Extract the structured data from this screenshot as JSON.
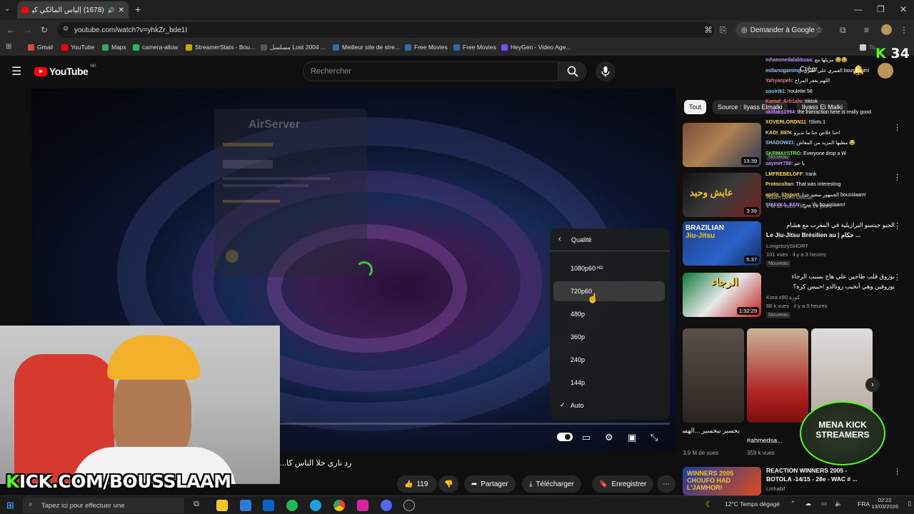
{
  "browser": {
    "tab_title": "(1678) إلياس المالكي كيرد عـ...",
    "url": "youtube.com/watch?v=yhkZr_bde1I",
    "translate_label": "Demander à Google",
    "bookmarks": [
      "Gmail",
      "YouTube",
      "Maps",
      "camera-allow",
      "StreamerStats - Bou...",
      "مسلسل Lost 2004 ...",
      "Meilleur site de stre...",
      "Free Movies",
      "Free Movies",
      "HeyGen - Video Age...",
      "To..."
    ],
    "bookmark_colors": [
      "#ea4335",
      "#ff0000",
      "#34a853",
      "#1fbf5f",
      "#c6a700",
      "#555555",
      "#2b6cb0",
      "#2b6cb0",
      "#2b6cb0",
      "#7c4dff",
      "#cccccc"
    ]
  },
  "youtube": {
    "logo_text": "YouTube",
    "region": "MA",
    "search_placeholder": "Rechercher",
    "create_label": "Créer"
  },
  "player": {
    "loading_title": "AirServer",
    "quality_menu_title": "Qualité",
    "qualities": [
      {
        "label": "1080p60",
        "badge": "HD",
        "selected": false
      },
      {
        "label": "720p60",
        "badge": "",
        "selected": false,
        "hovered": true
      },
      {
        "label": "480p",
        "badge": "",
        "selected": false
      },
      {
        "label": "360p",
        "badge": "",
        "selected": false
      },
      {
        "label": "240p",
        "badge": "",
        "selected": false
      },
      {
        "label": "144p",
        "badge": "",
        "selected": false
      },
      {
        "label": "Auto",
        "badge": "",
        "selected": true
      }
    ],
    "webcam_overlay_text": "K ICK.COM/BOUSSLAAM",
    "overlay_brand": "K",
    "overlay_rest": "ICK.COM/BOUSSLAAM"
  },
  "below_video": {
    "caption": "رد ناري خلا الناس كا...",
    "like_count": "119",
    "share_label": "Partager",
    "download_label": "Télécharger",
    "save_label": "Enregistrer"
  },
  "chips": [
    "Tout",
    "Source : Ilyass Elmalki",
    "Ilyass El Malki"
  ],
  "recommendations": [
    {
      "title": "",
      "channel": "",
      "meta": "",
      "duration": "13:39",
      "badge": "Nouveau"
    },
    {
      "title": "",
      "channel": "Haam Deen Official",
      "meta": "1 M de vues · il y a 10 jours",
      "duration": "3:39",
      "badge": ""
    },
    {
      "title": "الجيو جيتسو البرازيلية في المغرب مع هشام",
      "title2": "Le Jiu-Jitsu Brésilien au | حكام ...",
      "channel": "LongstorySHORT",
      "meta": "101 vues · il y a 3 heures",
      "duration": "5:37",
      "badge": "Nouveau"
    },
    {
      "title": "بوزوق قلب طاجين علي هاج بسبب الرجاء",
      "title2": "بوزوقين وهي أنجيب رونالدو /حبيس كرة؟",
      "channel": "Kora x90 كورة",
      "meta": "88 k vues · il y a 9 heures",
      "duration": "1:32:29",
      "badge": "Nouveau"
    },
    {
      "title": "REACTION WINNERS 2005 -",
      "title2": "BOTOLA -14/15 - 28e - WAC # ...",
      "channel": "Lmhabil",
      "meta": "",
      "duration": "",
      "badge": ""
    }
  ],
  "shorts": [
    {
      "title": "بحسير ببحسير ...الهسيلري بحسير",
      "views": "3,9 M de vues"
    },
    {
      "title": "#ahmedsa...",
      "views": "359 k vues"
    }
  ],
  "chat": {
    "viewer_count": "34",
    "lines": [
      {
        "name": "mhammedalabbsaa",
        "msg": ": مزيلها مع 😂😂",
        "color": "#c98bff"
      },
      {
        "name": "millanogaming",
        "msg": ": العمري علي عمري bousslaam!",
        "color": "#7fc8ff"
      },
      {
        "name": "Yahyaopeh",
        "msg": ": اللهم يغفر المراح",
        "color": "#ff6b6b"
      },
      {
        "name": "souiri91",
        "msg": ": !roulette 58",
        "color": "#7fc8ff"
      },
      {
        "name": "Kamal_Arb1ahi",
        "msg": ": !tiktok",
        "color": "#ff6b6b"
      },
      {
        "name": "xkillaks1994",
        "msg": ": the interaction here is really good.",
        "color": "#c98bff"
      },
      {
        "name": "XOVERLORDN11",
        "msg": ": !Slots 1",
        "color": "#ffd24d"
      },
      {
        "name": "KADI_BEN",
        "msg": ": احنا خلاص حتا ما نديرو",
        "color": "#ffd24d"
      },
      {
        "name": "SHADOW21",
        "msg": ": مطيها المزيد من المعاش 😂",
        "color": "#7fc8ff"
      },
      {
        "name": "SKRMAYSTRO",
        "msg": ": Everyone drop a W",
        "color": "#53fc18"
      },
      {
        "name": "saymer789",
        "msg": ": يا عم",
        "color": "#c98bff"
      },
      {
        "name": "LMFREBELOFF",
        "msg": ": !rank",
        "color": "#ffd24d"
      },
      {
        "name": "Protocoltan",
        "msg": ": That was interesting",
        "color": "#ffd24d"
      },
      {
        "name": "apelo_33sport",
        "msg": ": الجمهور سعيد جدا bousslaam!",
        "color": "#ffd24d"
      },
      {
        "name": "SMAYKA_FAN",
        "msg": ": يالا مزح bousslaam!",
        "color": "#c98bff"
      }
    ]
  },
  "taskbar": {
    "search_placeholder": "Tapez ici pour effectuer une",
    "weather": "12°C  Temps dégagé",
    "lang": "FRA",
    "time": "02:22",
    "date": "13/03/2026"
  }
}
